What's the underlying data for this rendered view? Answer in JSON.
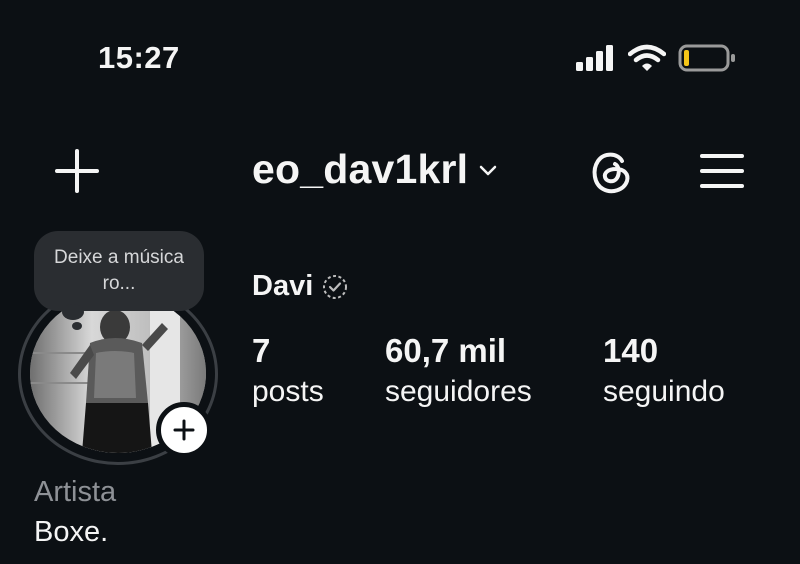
{
  "status_bar": {
    "time": "15:27",
    "icons": [
      "signal-icon",
      "wifi-icon",
      "battery-icon"
    ],
    "battery_level": 0.1
  },
  "header": {
    "username": "eo_dav1krl",
    "icons": [
      "plus-icon",
      "chevron-down-icon",
      "threads-icon",
      "menu-icon"
    ]
  },
  "note": {
    "text": "Deixe a música ro..."
  },
  "profile": {
    "display_name": "Davi",
    "stats": [
      {
        "value": "7",
        "label": "posts"
      },
      {
        "value": "60,7 mil",
        "label": "seguidores"
      },
      {
        "value": "140",
        "label": "seguindo"
      }
    ],
    "category": "Artista",
    "bio": "Boxe."
  },
  "colors": {
    "background": "#0c1014",
    "text": "#f5f5f5",
    "muted": "#8e9196",
    "bubble": "#2a2d31",
    "battery_low": "#f5c518"
  }
}
